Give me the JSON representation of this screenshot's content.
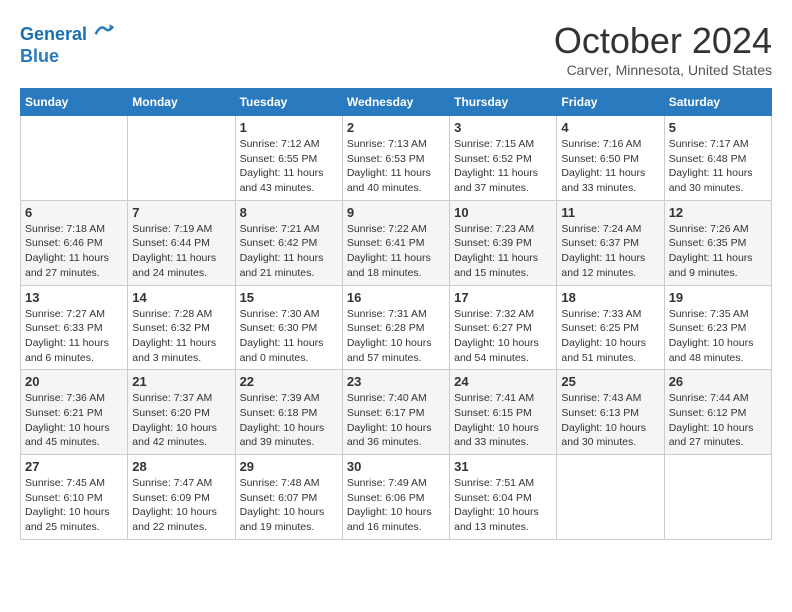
{
  "header": {
    "logo_line1": "General",
    "logo_line2": "Blue",
    "month_title": "October 2024",
    "location": "Carver, Minnesota, United States"
  },
  "days_of_week": [
    "Sunday",
    "Monday",
    "Tuesday",
    "Wednesday",
    "Thursday",
    "Friday",
    "Saturday"
  ],
  "weeks": [
    [
      {
        "day": "",
        "sunrise": "",
        "sunset": "",
        "daylight": ""
      },
      {
        "day": "",
        "sunrise": "",
        "sunset": "",
        "daylight": ""
      },
      {
        "day": "1",
        "sunrise": "Sunrise: 7:12 AM",
        "sunset": "Sunset: 6:55 PM",
        "daylight": "Daylight: 11 hours and 43 minutes."
      },
      {
        "day": "2",
        "sunrise": "Sunrise: 7:13 AM",
        "sunset": "Sunset: 6:53 PM",
        "daylight": "Daylight: 11 hours and 40 minutes."
      },
      {
        "day": "3",
        "sunrise": "Sunrise: 7:15 AM",
        "sunset": "Sunset: 6:52 PM",
        "daylight": "Daylight: 11 hours and 37 minutes."
      },
      {
        "day": "4",
        "sunrise": "Sunrise: 7:16 AM",
        "sunset": "Sunset: 6:50 PM",
        "daylight": "Daylight: 11 hours and 33 minutes."
      },
      {
        "day": "5",
        "sunrise": "Sunrise: 7:17 AM",
        "sunset": "Sunset: 6:48 PM",
        "daylight": "Daylight: 11 hours and 30 minutes."
      }
    ],
    [
      {
        "day": "6",
        "sunrise": "Sunrise: 7:18 AM",
        "sunset": "Sunset: 6:46 PM",
        "daylight": "Daylight: 11 hours and 27 minutes."
      },
      {
        "day": "7",
        "sunrise": "Sunrise: 7:19 AM",
        "sunset": "Sunset: 6:44 PM",
        "daylight": "Daylight: 11 hours and 24 minutes."
      },
      {
        "day": "8",
        "sunrise": "Sunrise: 7:21 AM",
        "sunset": "Sunset: 6:42 PM",
        "daylight": "Daylight: 11 hours and 21 minutes."
      },
      {
        "day": "9",
        "sunrise": "Sunrise: 7:22 AM",
        "sunset": "Sunset: 6:41 PM",
        "daylight": "Daylight: 11 hours and 18 minutes."
      },
      {
        "day": "10",
        "sunrise": "Sunrise: 7:23 AM",
        "sunset": "Sunset: 6:39 PM",
        "daylight": "Daylight: 11 hours and 15 minutes."
      },
      {
        "day": "11",
        "sunrise": "Sunrise: 7:24 AM",
        "sunset": "Sunset: 6:37 PM",
        "daylight": "Daylight: 11 hours and 12 minutes."
      },
      {
        "day": "12",
        "sunrise": "Sunrise: 7:26 AM",
        "sunset": "Sunset: 6:35 PM",
        "daylight": "Daylight: 11 hours and 9 minutes."
      }
    ],
    [
      {
        "day": "13",
        "sunrise": "Sunrise: 7:27 AM",
        "sunset": "Sunset: 6:33 PM",
        "daylight": "Daylight: 11 hours and 6 minutes."
      },
      {
        "day": "14",
        "sunrise": "Sunrise: 7:28 AM",
        "sunset": "Sunset: 6:32 PM",
        "daylight": "Daylight: 11 hours and 3 minutes."
      },
      {
        "day": "15",
        "sunrise": "Sunrise: 7:30 AM",
        "sunset": "Sunset: 6:30 PM",
        "daylight": "Daylight: 11 hours and 0 minutes."
      },
      {
        "day": "16",
        "sunrise": "Sunrise: 7:31 AM",
        "sunset": "Sunset: 6:28 PM",
        "daylight": "Daylight: 10 hours and 57 minutes."
      },
      {
        "day": "17",
        "sunrise": "Sunrise: 7:32 AM",
        "sunset": "Sunset: 6:27 PM",
        "daylight": "Daylight: 10 hours and 54 minutes."
      },
      {
        "day": "18",
        "sunrise": "Sunrise: 7:33 AM",
        "sunset": "Sunset: 6:25 PM",
        "daylight": "Daylight: 10 hours and 51 minutes."
      },
      {
        "day": "19",
        "sunrise": "Sunrise: 7:35 AM",
        "sunset": "Sunset: 6:23 PM",
        "daylight": "Daylight: 10 hours and 48 minutes."
      }
    ],
    [
      {
        "day": "20",
        "sunrise": "Sunrise: 7:36 AM",
        "sunset": "Sunset: 6:21 PM",
        "daylight": "Daylight: 10 hours and 45 minutes."
      },
      {
        "day": "21",
        "sunrise": "Sunrise: 7:37 AM",
        "sunset": "Sunset: 6:20 PM",
        "daylight": "Daylight: 10 hours and 42 minutes."
      },
      {
        "day": "22",
        "sunrise": "Sunrise: 7:39 AM",
        "sunset": "Sunset: 6:18 PM",
        "daylight": "Daylight: 10 hours and 39 minutes."
      },
      {
        "day": "23",
        "sunrise": "Sunrise: 7:40 AM",
        "sunset": "Sunset: 6:17 PM",
        "daylight": "Daylight: 10 hours and 36 minutes."
      },
      {
        "day": "24",
        "sunrise": "Sunrise: 7:41 AM",
        "sunset": "Sunset: 6:15 PM",
        "daylight": "Daylight: 10 hours and 33 minutes."
      },
      {
        "day": "25",
        "sunrise": "Sunrise: 7:43 AM",
        "sunset": "Sunset: 6:13 PM",
        "daylight": "Daylight: 10 hours and 30 minutes."
      },
      {
        "day": "26",
        "sunrise": "Sunrise: 7:44 AM",
        "sunset": "Sunset: 6:12 PM",
        "daylight": "Daylight: 10 hours and 27 minutes."
      }
    ],
    [
      {
        "day": "27",
        "sunrise": "Sunrise: 7:45 AM",
        "sunset": "Sunset: 6:10 PM",
        "daylight": "Daylight: 10 hours and 25 minutes."
      },
      {
        "day": "28",
        "sunrise": "Sunrise: 7:47 AM",
        "sunset": "Sunset: 6:09 PM",
        "daylight": "Daylight: 10 hours and 22 minutes."
      },
      {
        "day": "29",
        "sunrise": "Sunrise: 7:48 AM",
        "sunset": "Sunset: 6:07 PM",
        "daylight": "Daylight: 10 hours and 19 minutes."
      },
      {
        "day": "30",
        "sunrise": "Sunrise: 7:49 AM",
        "sunset": "Sunset: 6:06 PM",
        "daylight": "Daylight: 10 hours and 16 minutes."
      },
      {
        "day": "31",
        "sunrise": "Sunrise: 7:51 AM",
        "sunset": "Sunset: 6:04 PM",
        "daylight": "Daylight: 10 hours and 13 minutes."
      },
      {
        "day": "",
        "sunrise": "",
        "sunset": "",
        "daylight": ""
      },
      {
        "day": "",
        "sunrise": "",
        "sunset": "",
        "daylight": ""
      }
    ]
  ]
}
